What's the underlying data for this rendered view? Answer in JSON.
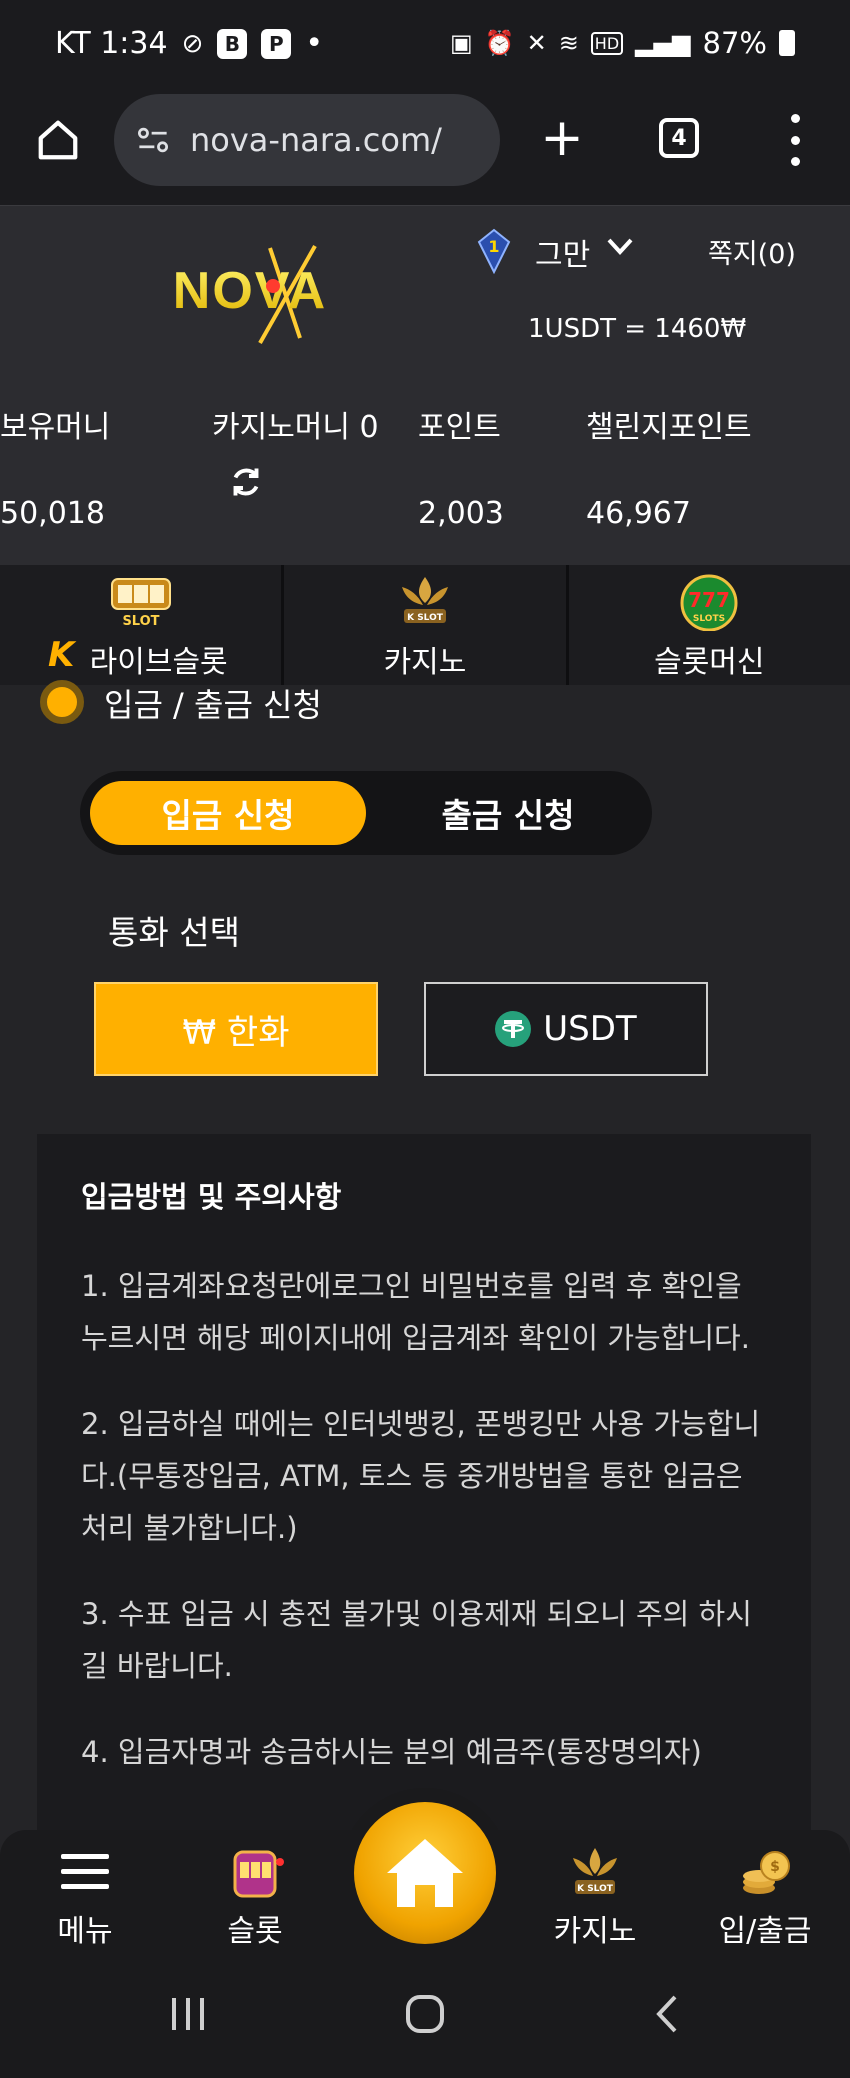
{
  "status_bar": {
    "carrier_time": "KT 1:34",
    "notif_icons": [
      "link-icon",
      "b-app-icon",
      "p-app-icon"
    ],
    "dot": "•",
    "battery": "87%"
  },
  "browser": {
    "url": "nova-nara.com/",
    "tab_count": "4"
  },
  "header": {
    "logo_text": "NOVA",
    "level": "1",
    "user_name": "그만",
    "messages": "쪽지(0)",
    "exchange_rate": "1USDT = 1460₩"
  },
  "balances": [
    {
      "label": "보유머니",
      "value": "50,018"
    },
    {
      "label": "카지노머니 0",
      "value": ""
    },
    {
      "label": "포인트",
      "value": "2,003"
    },
    {
      "label": "챌린지포인트",
      "value": "46,967"
    }
  ],
  "categories": [
    {
      "label": "라이브슬롯",
      "icon": "live-slot-icon"
    },
    {
      "label": "카지노",
      "icon": "k-slot-casino-icon"
    },
    {
      "label": "슬롯머신",
      "icon": "777-slots-icon"
    }
  ],
  "section": {
    "title": "입금 / 출금 신청"
  },
  "tabs": {
    "deposit": "입금 신청",
    "withdraw": "출금 신청"
  },
  "currency": {
    "label": "통화 선택",
    "krw": "₩ 한화",
    "usdt": "USDT"
  },
  "info": {
    "title": "입금방법 및 주의사항",
    "paragraphs": [
      "1. 입금계좌요청란에로그인 비밀번호를 입력 후 확인을 누르시면 해당 페이지내에 입금계좌 확인이 가능합니다.",
      "2. 입금하실 때에는 인터넷뱅킹, 폰뱅킹만 사용 가능합니다.(무통장입금, ATM, 토스 등 중개방법을 통한 입금은 처리 불가합니다.)",
      "3. 수표 입금 시 충전 불가및 이용제재 되오니 주의 하시길 바랍니다.",
      "4. 입금자명과 송금하시는 분의 예금주(통장명의자)"
    ]
  },
  "bottom_nav": {
    "menu": "메뉴",
    "slot": "슬롯",
    "casino": "카지노",
    "deposit_withdraw": "입/출금"
  },
  "colors": {
    "accent": "#ffb000",
    "background": "#242427",
    "panel": "#1b1b1e"
  }
}
